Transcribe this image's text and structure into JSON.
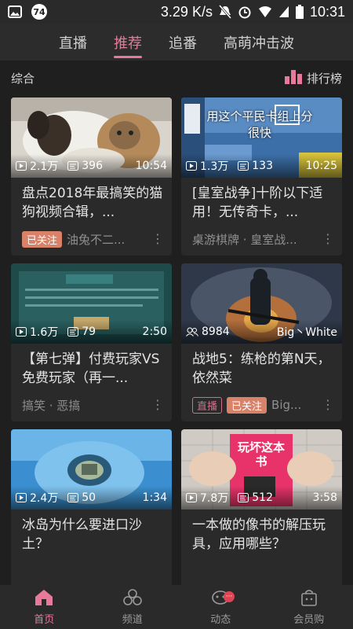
{
  "status": {
    "notif_count": "74",
    "speed": "3.29 K/s",
    "time": "10:31"
  },
  "tabs": [
    {
      "label": "直播"
    },
    {
      "label": "推荐"
    },
    {
      "label": "追番"
    },
    {
      "label": "高萌冲击波"
    }
  ],
  "section": {
    "title": "综合",
    "rank_label": "排行榜"
  },
  "cards": [
    {
      "views": "2.1万",
      "danmaku": "396",
      "duration": "10:54",
      "title": "盘点2018年最搞笑的猫狗视频合辑，...",
      "tag": "已关注",
      "foot": "油兔不二..."
    },
    {
      "views": "1.3万",
      "danmaku": "133",
      "duration": "10:25",
      "title": "[皇室战争]十阶以下适用！无传奇卡，...",
      "foot": "桌游棋牌 · 皇室战...",
      "overlay": "用这个平民卡组上分很快"
    },
    {
      "views": "1.6万",
      "danmaku": "79",
      "duration": "2:50",
      "title": "【第七弹】付费玩家VS免费玩家（再一...",
      "foot": "搞笑 · 恶搞"
    },
    {
      "viewers": "8984",
      "streamer": "Big丶White",
      "title": "战地5：练枪的第N天，依然菜",
      "live_tag": "直播",
      "tag": "已关注",
      "foot": "Big..."
    },
    {
      "views": "2.4万",
      "danmaku": "50",
      "duration": "1:34",
      "title": "冰岛为什么要进口沙土？"
    },
    {
      "views": "7.8万",
      "danmaku": "512",
      "duration": "3:58",
      "title": "一本做的像书的解压玩具，应用哪些？",
      "book_text": "玩坏这本书"
    }
  ],
  "nav": [
    {
      "label": "首页"
    },
    {
      "label": "频道"
    },
    {
      "label": "动态"
    },
    {
      "label": "会员购"
    }
  ],
  "colors": {
    "accent": "#e77a9b",
    "follow_tag": "#d9826a",
    "badge": "#e04452"
  }
}
